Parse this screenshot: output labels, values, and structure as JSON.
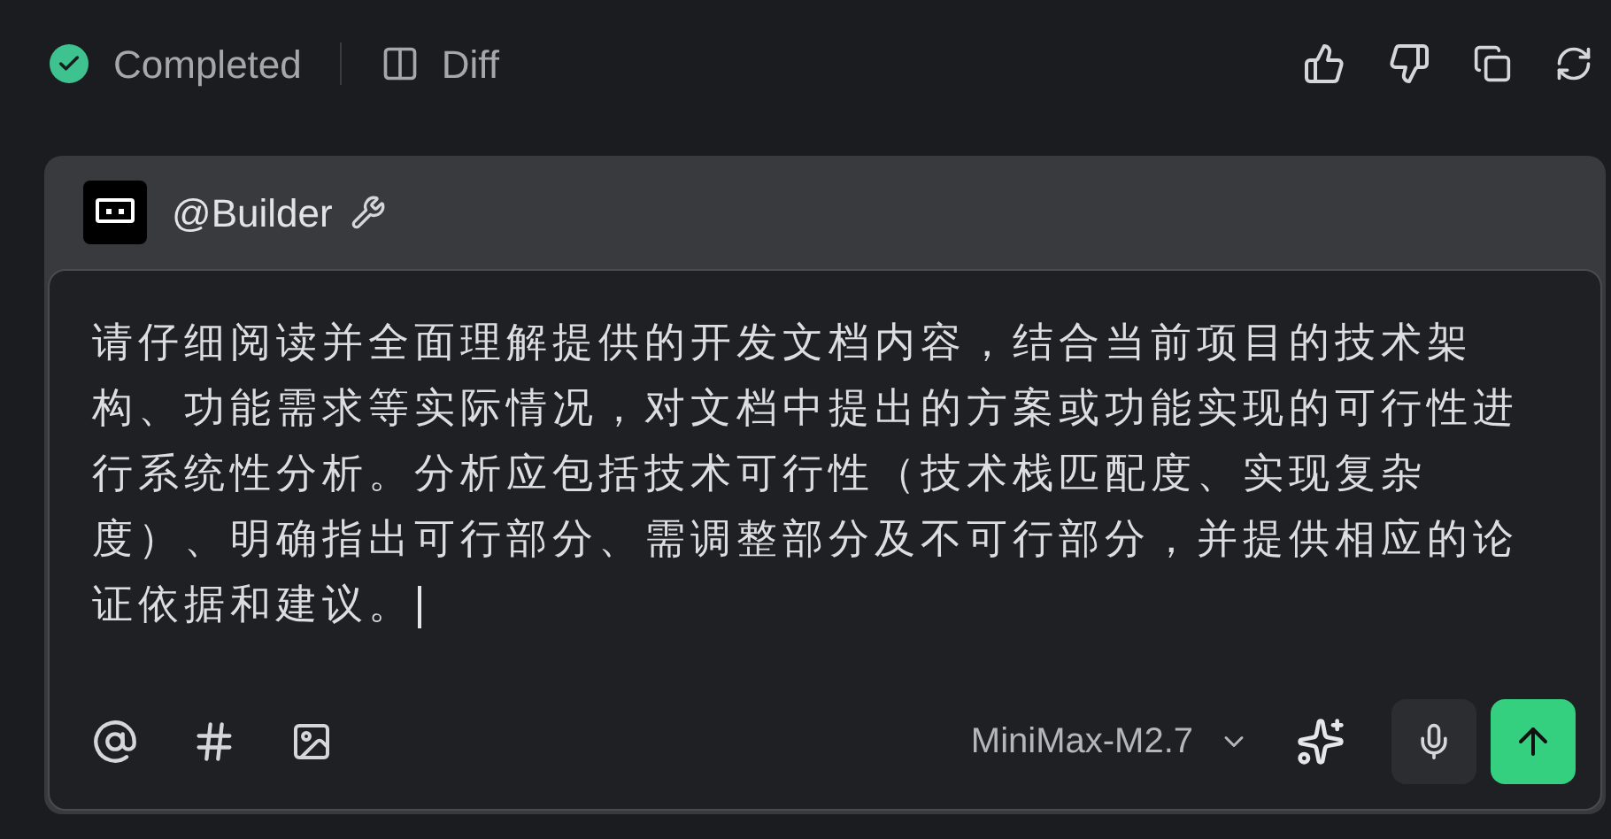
{
  "status": {
    "label": "Completed",
    "done": true
  },
  "diff": {
    "label": "Diff"
  },
  "composer": {
    "agent": "@Builder",
    "text": "请仔细阅读并全面理解提供的开发文档内容，结合当前项目的技术架构、功能需求等实际情况，对文档中提出的方案或功能实现的可行性进行系统性分析。分析应包括技术可行性（技术栈匹配度、实现复杂度）、明确指出可行部分、需调整部分及不可行部分，并提供相应的论证依据和建议。",
    "model": "MiniMax-M2.7"
  }
}
